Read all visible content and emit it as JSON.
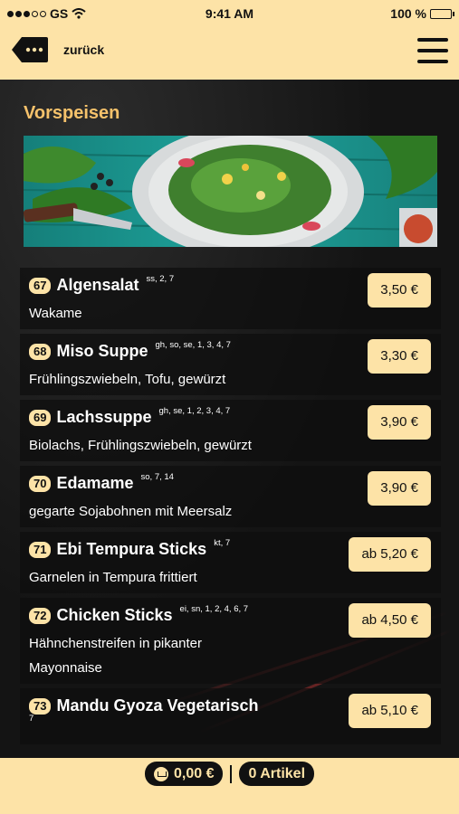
{
  "status": {
    "carrier": "GS",
    "time": "9:41 AM",
    "battery": "100 %"
  },
  "nav": {
    "back_label": "zurück"
  },
  "section": {
    "title": "Vorspeisen"
  },
  "items": [
    {
      "num": "67",
      "name": "Algensalat",
      "allergens": "ss, 2, 7",
      "desc": "Wakame",
      "price": "3,50 €"
    },
    {
      "num": "68",
      "name": "Miso Suppe",
      "allergens": "gh, so, se, 1, 3, 4, 7",
      "desc": "Frühlingszwiebeln, Tofu, gewürzt",
      "price": "3,30 €"
    },
    {
      "num": "69",
      "name": "Lachssuppe",
      "allergens": "gh, se, 1, 2, 3, 4, 7",
      "desc": "Biolachs, Frühlingszwiebeln, gewürzt",
      "price": "3,90 €"
    },
    {
      "num": "70",
      "name": "Edamame",
      "allergens": "so, 7, 14",
      "desc": "gegarte Sojabohnen mit Meersalz",
      "price": "3,90 €"
    },
    {
      "num": "71",
      "name": "Ebi Tempura Sticks",
      "allergens": "kt, 7",
      "desc": "Garnelen in Tempura frittiert",
      "price": "ab 5,20 €"
    },
    {
      "num": "72",
      "name": "Chicken Sticks",
      "allergens": "ei, sn, 1, 2, 4, 6, 7",
      "desc": "Hähnchenstreifen in pikanter Mayonnaise",
      "price": "ab 4,50 €"
    },
    {
      "num": "73",
      "name": "Mandu Gyoza Vegetarisch",
      "allergens": "7",
      "desc": "",
      "price": "ab 5,10 €"
    }
  ],
  "cart": {
    "total": "0,00 €",
    "count": "0 Artikel"
  },
  "colors": {
    "accent": "#fde3a7",
    "title": "#f6c26b",
    "background": "#141414"
  }
}
